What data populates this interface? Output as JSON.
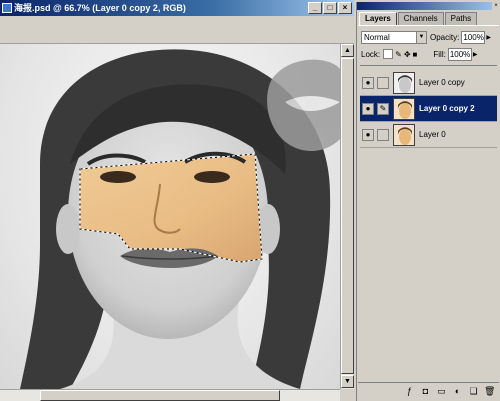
{
  "document": {
    "title": "海报.psd @ 66.7% (Layer 0 copy 2, RGB)",
    "window_buttons": [
      "_",
      "□",
      "×"
    ]
  },
  "palette": {
    "tabs": [
      {
        "label": "Layers",
        "active": true
      },
      {
        "label": "Channels",
        "active": false
      },
      {
        "label": "Paths",
        "active": false
      }
    ],
    "blend_mode": "Normal",
    "opacity_label": "Opacity:",
    "opacity_value": "100%",
    "lock_label": "Lock:",
    "fill_label": "Fill:",
    "fill_value": "100%",
    "layers": [
      {
        "name": "Layer 0 copy",
        "visible": true,
        "selected": false,
        "brush": false
      },
      {
        "name": "Layer 0 copy 2",
        "visible": true,
        "selected": true,
        "brush": true
      },
      {
        "name": "Layer 0",
        "visible": true,
        "selected": false,
        "brush": false
      }
    ],
    "footer_icons": [
      "layer-style-icon",
      "mask-icon",
      "new-set-icon",
      "adjustment-layer-icon",
      "new-layer-icon",
      "trash-icon"
    ]
  },
  "colors": {
    "title_bar": "#0a246a",
    "selected_layer": "#0a246a",
    "panel_bg": "#d4d0c8"
  }
}
